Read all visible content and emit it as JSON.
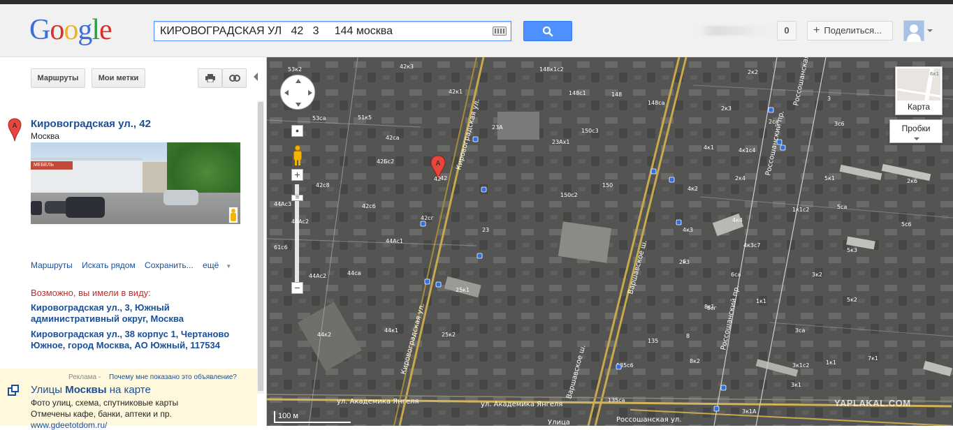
{
  "header": {
    "logo_letters": [
      {
        "ch": "G",
        "color": "#3c6fd6"
      },
      {
        "ch": "o",
        "color": "#d6312a"
      },
      {
        "ch": "o",
        "color": "#eab52b"
      },
      {
        "ch": "g",
        "color": "#3c6fd6"
      },
      {
        "ch": "l",
        "color": "#2e9b47"
      },
      {
        "ch": "e",
        "color": "#d6312a"
      }
    ],
    "search_value": "КИРОВОГРАДСКАЯ УЛ   42   3     144 москва",
    "search_button_icon": "search-icon",
    "keyboard_icon": "keyboard-icon",
    "notification_count": "0",
    "share_label": "Поделиться...",
    "avatar_icon": "avatar-icon"
  },
  "panel": {
    "toolbar": {
      "routes_label": "Маршруты",
      "my_places_label": "Мои метки",
      "print_icon": "print-icon",
      "link_icon": "link-icon",
      "collapse_icon": "collapse-left-icon"
    },
    "result": {
      "marker_letter": "A",
      "title": "Кировоградская ул., 42",
      "city": "Москва",
      "photo_sign": "МЕБЕЛЬ"
    },
    "actions": [
      "Маршруты",
      "Искать рядом",
      "Сохранить...",
      "ещё"
    ],
    "maybe_label": "Возможно, вы имели в виду:",
    "suggestions": [
      {
        "line1": "Кировоградская ул., 3, Южный",
        "line2": "административный округ, Москва"
      },
      {
        "line1": "Кировоградская ул., 38 корпус 1, Чертаново",
        "line2": "Южное, город Москва, АО Южный, 117534"
      }
    ],
    "ad": {
      "label": "Реклама",
      "separator": "-",
      "why": "Почему мне показано это объявление?",
      "title_pre": "Улицы ",
      "title_bold": "Москвы",
      "title_post": " на карте",
      "line1": "Фото улиц, схема, спутниковые карты",
      "line2": "Отмечены кафе, банки, аптеки и пр.",
      "url": "www.gdeetotdom.ru/"
    }
  },
  "map": {
    "controls": {
      "pan_icon": "pan-control-icon",
      "zoom_in": "+",
      "zoom_out": "−",
      "pegman_icon": "pegman-icon",
      "map_type_label": "Карта",
      "map_type_thumb_label": "6к1",
      "traffic_label": "Пробки"
    },
    "marker_letter": "A",
    "marker_label": "42",
    "scale_label": "100 м",
    "watermark": "YAPLAKAL.COM",
    "streets": [
      "Кировоградская ул.",
      "ул. Академика Янгеля",
      "ул. Академика Янгеля",
      "Варшавское ш.",
      "Варшавское ш.",
      "Россошанский пр.",
      "Россошанский пр.",
      "Россошанская ул.",
      "Улица"
    ],
    "building_labels": [
      "53к2",
      "42к3",
      "148к1с2",
      "42к1",
      "148",
      "148с1",
      "148са",
      "53са",
      "51к5",
      "42са",
      "23А",
      "150с3",
      "23Ах1",
      "42Бс2",
      "42с8",
      "42",
      "42с6",
      "150",
      "150с2",
      "44Ас3",
      "42сг",
      "23",
      "44Ас2",
      "44Ас1",
      "61с6",
      "44Ас2",
      "44са",
      "25к1",
      "44к2",
      "44к1",
      "25к2",
      "135",
      "135с6",
      "135са",
      "2к2",
      "2к3",
      "3",
      "3с6",
      "2са",
      "4к1",
      "4к1с4",
      "2к4",
      "4к2",
      "4к3",
      "4к4",
      "4к3с7",
      "6к1",
      "5к1",
      "5са",
      "1к1с2",
      "2к3",
      "6",
      "6са",
      "5с6",
      "5к3",
      "3к2",
      "8",
      "8к2",
      "8с1",
      "8сг",
      "1к1",
      "5к2",
      "3са",
      "3к1с2",
      "3к1",
      "1к1",
      "7к1",
      "2к6",
      "3к1А"
    ]
  }
}
